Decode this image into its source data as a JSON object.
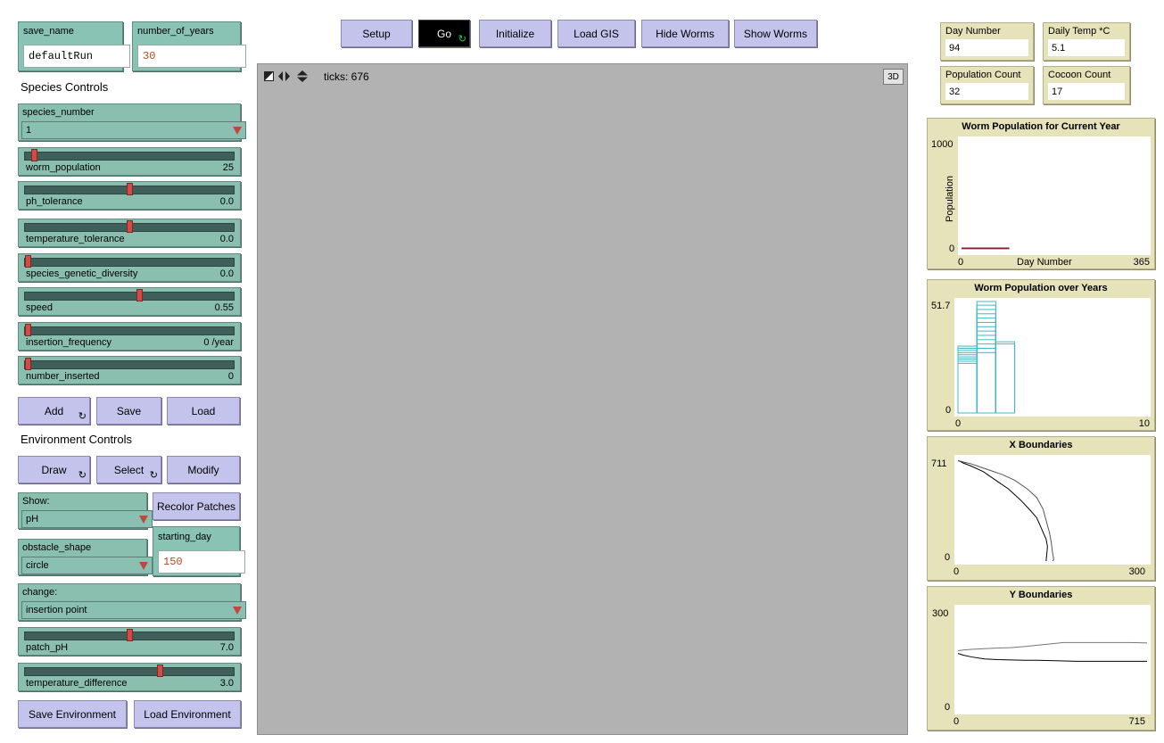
{
  "inputs": {
    "save_name": {
      "label": "save_name",
      "value": "defaultRun"
    },
    "number_of_years": {
      "label": "number_of_years",
      "value": "30"
    },
    "starting_day": {
      "label": "starting_day",
      "value": "150"
    }
  },
  "sections": {
    "species_controls": "Species Controls",
    "environment_controls": "Environment Controls"
  },
  "choosers": {
    "species_number": {
      "label": "species_number",
      "value": "1"
    },
    "show": {
      "label": "Show:",
      "value": "pH"
    },
    "obstacle_shape": {
      "label": "obstacle_shape",
      "value": "circle"
    },
    "change": {
      "label": "change:",
      "value": "insertion point"
    }
  },
  "sliders": {
    "worm_population": {
      "label": "worm_population",
      "value": "25",
      "fraction": 0.03
    },
    "ph_tolerance": {
      "label": "ph_tolerance",
      "value": "0.0",
      "fraction": 0.5
    },
    "temperature_tolerance": {
      "label": "temperature_tolerance",
      "value": "0.0",
      "fraction": 0.5
    },
    "species_genetic_diversity": {
      "label": "species_genetic_diversity",
      "value": "0.0",
      "fraction": 0.0
    },
    "speed": {
      "label": "speed",
      "value": "0.55",
      "fraction": 0.55
    },
    "insertion_frequency": {
      "label": "insertion_frequency",
      "value": "0 /year",
      "fraction": 0.0
    },
    "number_inserted": {
      "label": "number_inserted",
      "value": "0",
      "fraction": 0.0
    },
    "patch_pH": {
      "label": "patch_pH",
      "value": "7.0",
      "fraction": 0.5
    },
    "temperature_difference": {
      "label": "temperature_difference",
      "value": "3.0",
      "fraction": 0.65
    }
  },
  "buttons": {
    "add": "Add",
    "save": "Save",
    "load": "Load",
    "draw": "Draw",
    "select": "Select",
    "modify": "Modify",
    "recolor_patches": "Recolor Patches",
    "save_environment": "Save Environment",
    "load_environment": "Load Environment",
    "setup": "Setup",
    "go": "Go",
    "initialize": "Initialize",
    "load_gis": "Load GIS",
    "hide_worms": "Hide Worms",
    "show_worms": "Show Worms",
    "forever_glyph": "↻"
  },
  "view": {
    "ticks": "ticks: 676",
    "three_d": "3D"
  },
  "monitors": {
    "day_number": {
      "label": "Day Number",
      "value": "94"
    },
    "daily_temp": {
      "label": "Daily Temp *C",
      "value": "5.1"
    },
    "population_count": {
      "label": "Population Count",
      "value": "32"
    },
    "cocoon_count": {
      "label": "Cocoon Count",
      "value": "17"
    }
  },
  "chart_data": [
    {
      "type": "line",
      "title": "Worm Population for Current Year",
      "xlabel": "Day Number",
      "ylabel": "Population",
      "xlim": [
        0,
        365
      ],
      "ylim": [
        0,
        1000
      ],
      "x_min_label": "0",
      "x_max_label": "365",
      "y_min_label": "0",
      "y_max_label": "1000",
      "series": [
        {
          "color": "#8b1a3a",
          "x": [
            0,
            94
          ],
          "y": [
            25,
            25
          ]
        },
        {
          "color": "#8b1a3a",
          "x": [
            0,
            94
          ],
          "y": [
            32,
            32
          ]
        }
      ]
    },
    {
      "type": "bar",
      "title": "Worm Population over Years",
      "xlim": [
        0,
        10
      ],
      "ylim": [
        0,
        51.7
      ],
      "x_min_label": "0",
      "x_max_label": "10",
      "y_min_label": "0",
      "y_max_label": "51.7",
      "bar_color": "#3fb8c7",
      "bars": [
        {
          "x": 0,
          "values": [
            23,
            24,
            25,
            26,
            27,
            28,
            29,
            30,
            31
          ]
        },
        {
          "x": 1,
          "values": [
            28,
            30,
            32,
            34,
            36,
            38,
            40,
            42,
            44,
            46,
            48,
            50,
            51.7
          ]
        },
        {
          "x": 2,
          "values": [
            32,
            33
          ]
        }
      ]
    },
    {
      "type": "line",
      "title": "X Boundaries",
      "xlim": [
        0,
        300
      ],
      "ylim": [
        0,
        711
      ],
      "x_min_label": "0",
      "x_max_label": "300",
      "y_min_label": "0",
      "y_max_label": "711",
      "series": [
        {
          "color": "#000000",
          "x": [
            0,
            4,
            8,
            20,
            40,
            60,
            80,
            100,
            115,
            125,
            130,
            135,
            140,
            142,
            141,
            140,
            140
          ],
          "y": [
            696,
            690,
            680,
            660,
            620,
            560,
            500,
            420,
            350,
            300,
            250,
            200,
            150,
            100,
            50,
            10,
            0
          ]
        },
        {
          "color": "#555555",
          "x": [
            0,
            10,
            20,
            30,
            50,
            70,
            90,
            110,
            125,
            135,
            140,
            145,
            148,
            150,
            152,
            150
          ],
          "y": [
            697,
            685,
            675,
            660,
            630,
            600,
            560,
            500,
            440,
            360,
            280,
            200,
            130,
            60,
            10,
            0
          ]
        }
      ]
    },
    {
      "type": "line",
      "title": "Y Boundaries",
      "xlim": [
        0,
        715
      ],
      "ylim": [
        0,
        300
      ],
      "x_min_label": "0",
      "x_max_label": "715",
      "y_min_label": "0",
      "y_max_label": "300",
      "series": [
        {
          "color": "#000000",
          "x": [
            0,
            20,
            50,
            100,
            150,
            200,
            250,
            300,
            350,
            400,
            450,
            500,
            550,
            600,
            650,
            700,
            715
          ],
          "y": [
            168,
            163,
            158,
            152,
            150,
            149,
            148,
            148,
            147,
            146,
            145,
            145,
            145,
            145,
            145,
            145,
            145
          ]
        },
        {
          "color": "#777777",
          "x": [
            0,
            20,
            50,
            100,
            150,
            200,
            250,
            300,
            350,
            400,
            450,
            500,
            550,
            600,
            650,
            700,
            715
          ],
          "y": [
            176,
            178,
            180,
            182,
            184,
            185,
            188,
            192,
            196,
            200,
            200,
            200,
            200,
            200,
            200,
            199,
            199
          ]
        }
      ]
    }
  ]
}
